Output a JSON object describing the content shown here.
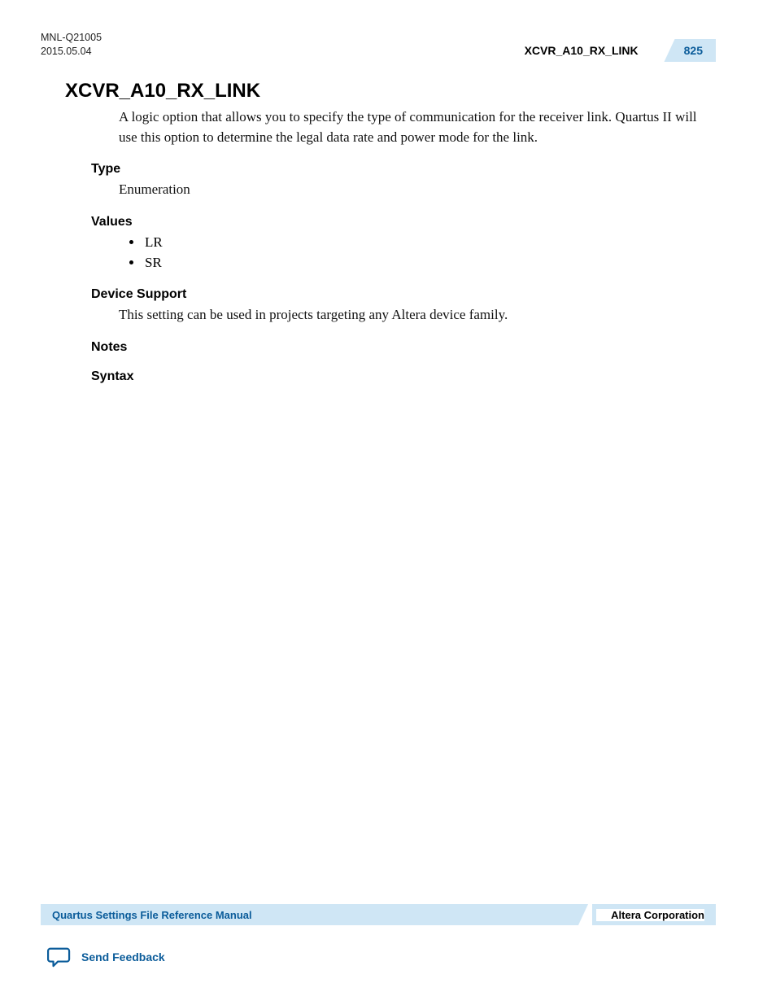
{
  "header": {
    "doc_id": "MNL-Q21005",
    "date": "2015.05.04",
    "running_title": "XCVR_A10_RX_LINK",
    "page_number": "825"
  },
  "title": "XCVR_A10_RX_LINK",
  "intro": "A logic option that allows you to specify the type of communication for the receiver link. Quartus II will use this option to determine the legal data rate and power mode for the link.",
  "sections": {
    "type": {
      "label": "Type",
      "body": "Enumeration"
    },
    "values": {
      "label": "Values",
      "items": [
        "LR",
        "SR"
      ]
    },
    "device_support": {
      "label": "Device Support",
      "body": "This setting can be used in projects targeting any Altera device family."
    },
    "notes": {
      "label": "Notes"
    },
    "syntax": {
      "label": "Syntax"
    }
  },
  "footer": {
    "manual": "Quartus Settings File Reference Manual",
    "company": "Altera Corporation",
    "feedback": "Send Feedback"
  }
}
